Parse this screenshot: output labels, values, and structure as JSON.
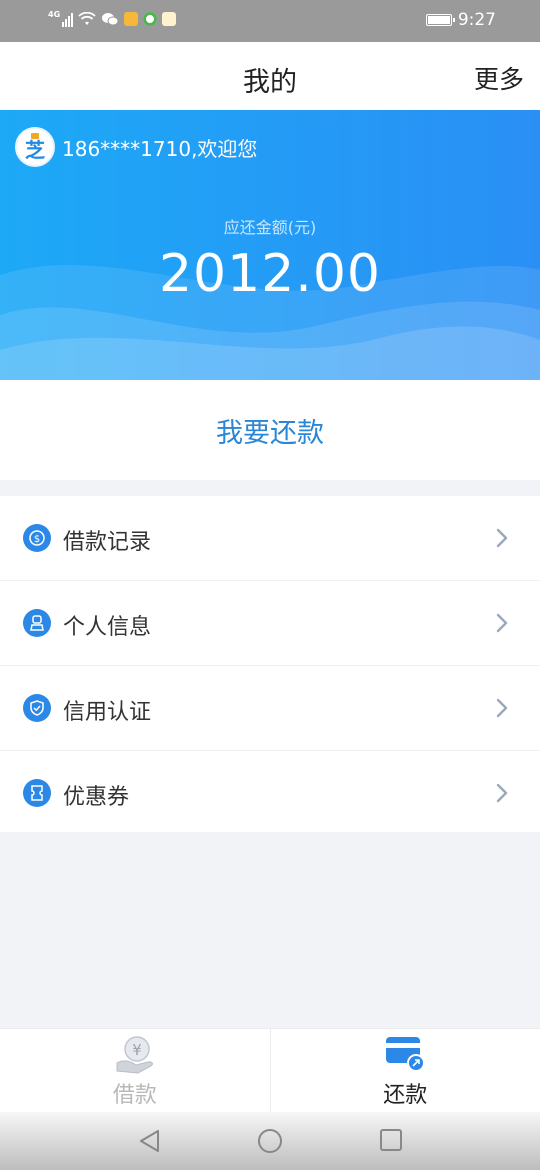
{
  "status_bar": {
    "network": "4G",
    "time": "9:27"
  },
  "header": {
    "title": "我的",
    "more_label": "更多"
  },
  "banner": {
    "welcome": "186****1710,欢迎您",
    "amount_label": "应还金额(元)",
    "amount": "2012.00",
    "avatar_text": "芝"
  },
  "repay_button": {
    "label": "我要还款"
  },
  "menu": {
    "items": [
      {
        "label": "借款记录",
        "icon": "coin-icon"
      },
      {
        "label": "个人信息",
        "icon": "person-icon"
      },
      {
        "label": "信用认证",
        "icon": "shield-icon"
      },
      {
        "label": "优惠券",
        "icon": "coupon-icon"
      }
    ]
  },
  "tabbar": {
    "tabs": [
      {
        "label": "借款",
        "icon": "yuan-hand-icon",
        "active": false
      },
      {
        "label": "还款",
        "icon": "card-icon",
        "active": true
      }
    ]
  },
  "colors": {
    "brand_blue": "#2a8ff5",
    "link_blue": "#2b86d6",
    "background": "#f2f3f7"
  }
}
